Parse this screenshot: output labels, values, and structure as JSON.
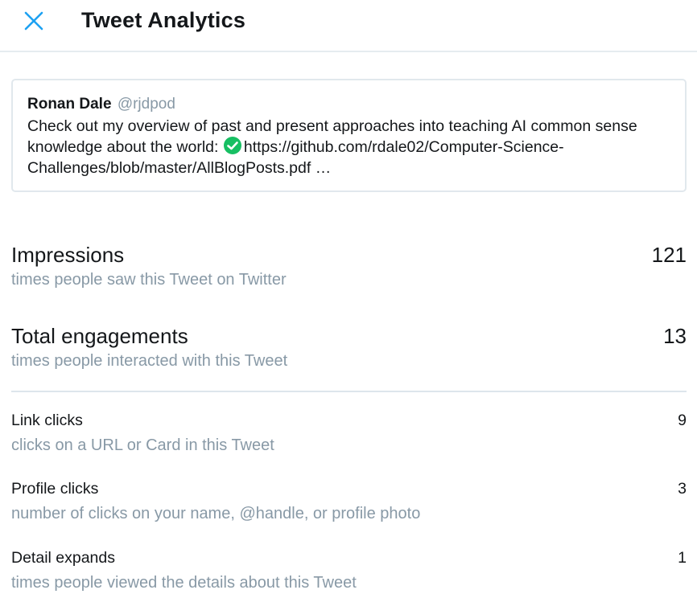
{
  "header": {
    "title": "Tweet Analytics",
    "close_icon": "close-icon"
  },
  "tweet": {
    "author_name": "Ronan Dale",
    "author_handle": "@rjdpod",
    "text_line1": "Check out my overview of past and present approaches into teaching AI common sense knowledge about the world:",
    "emoji_icon": "check-mark-icon",
    "link_text": "https://github.com/rdale02/Computer-Science-Challenges/blob/master/AllBlogPosts.pdf …"
  },
  "primary_metrics": [
    {
      "label": "Impressions",
      "value": "121",
      "description": "times people saw this Tweet on Twitter"
    },
    {
      "label": "Total engagements",
      "value": "13",
      "description": "times people interacted with this Tweet"
    }
  ],
  "secondary_metrics": [
    {
      "label": "Link clicks",
      "value": "9",
      "description": "clicks on a URL or Card in this Tweet"
    },
    {
      "label": "Profile clicks",
      "value": "3",
      "description": "number of clicks on your name, @handle, or profile photo"
    },
    {
      "label": "Detail expands",
      "value": "1",
      "description": "times people viewed the details about this Tweet"
    }
  ],
  "colors": {
    "accent": "#1da1f2",
    "muted_text": "#8899a6",
    "check_green": "#17bf63"
  }
}
